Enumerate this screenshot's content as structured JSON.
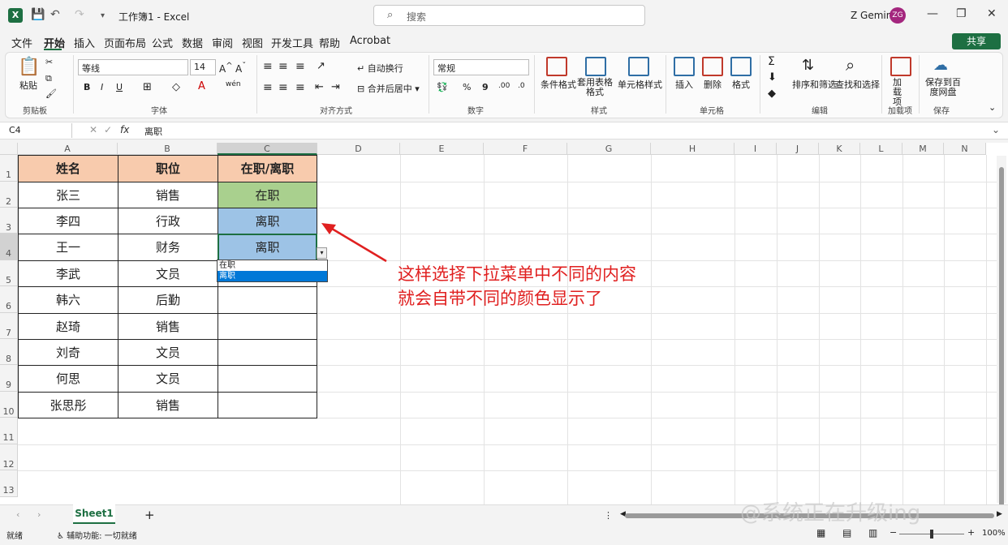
{
  "title_bar": {
    "doc_title": "工作簿1  -  Excel",
    "search_placeholder": "搜索",
    "user_name": "Z Gemini",
    "avatar_initials": "ZG"
  },
  "menu": [
    "文件",
    "开始",
    "插入",
    "页面布局",
    "公式",
    "数据",
    "审阅",
    "视图",
    "开发工具",
    "帮助",
    "Acrobat"
  ],
  "share_label": "共享",
  "ribbon": {
    "paste": "粘贴",
    "font_name": "等线",
    "font_size": "14",
    "wrap": "自动换行",
    "merge": "合并后居中",
    "number_format": "常规",
    "cond_format": "条件格式",
    "table_format": "套用表格格式",
    "cell_style": "单元格样式",
    "insert": "插入",
    "delete": "删除",
    "format": "格式",
    "sort_filter": "排序和筛选",
    "find_select": "查找和选择",
    "addins": "加载项",
    "save_baidu": "保存到百度网盘",
    "bold": "B",
    "italic": "I",
    "underline": "U",
    "groups": [
      "剪贴板",
      "字体",
      "对齐方式",
      "数字",
      "样式",
      "单元格",
      "编辑",
      "加载项",
      "保存"
    ]
  },
  "formula_bar": {
    "name_box": "C4",
    "fx": "fx",
    "value": "离职"
  },
  "columns": [
    "A",
    "B",
    "C",
    "D",
    "E",
    "F",
    "G",
    "H",
    "I",
    "J",
    "K",
    "L",
    "M",
    "N"
  ],
  "rows": [
    "1",
    "2",
    "3",
    "4",
    "5",
    "6",
    "7",
    "8",
    "9",
    "10",
    "11",
    "12",
    "13"
  ],
  "table": {
    "headers": [
      "姓名",
      "职位",
      "在职/离职"
    ],
    "rows": [
      [
        "张三",
        "销售",
        "在职"
      ],
      [
        "李四",
        "行政",
        "离职"
      ],
      [
        "王一",
        "财务",
        "离职"
      ],
      [
        "李武",
        "文员",
        ""
      ],
      [
        "韩六",
        "后勤",
        ""
      ],
      [
        "赵琦",
        "销售",
        ""
      ],
      [
        "刘奇",
        "文员",
        ""
      ],
      [
        "何思",
        "文员",
        ""
      ],
      [
        "张思彤",
        "销售",
        ""
      ]
    ]
  },
  "dropdown": {
    "options": [
      "在职",
      "离职"
    ],
    "highlighted": "离职"
  },
  "annotation": {
    "line1": "这样选择下拉菜单中不同的内容",
    "line2": "就会自带不同的颜色显示了",
    "color": "#e02020"
  },
  "sheet_tab": "Sheet1",
  "status": {
    "mode": "就绪",
    "accessibility": "辅助功能: 一切就绪",
    "zoom": "100%"
  },
  "watermark": "@系统正在升级ing",
  "colors": {
    "header_fill": "#f8cbad",
    "employed_fill": "#a9d08e",
    "resigned_fill": "#9dc3e6",
    "accent": "#1d6f42"
  }
}
